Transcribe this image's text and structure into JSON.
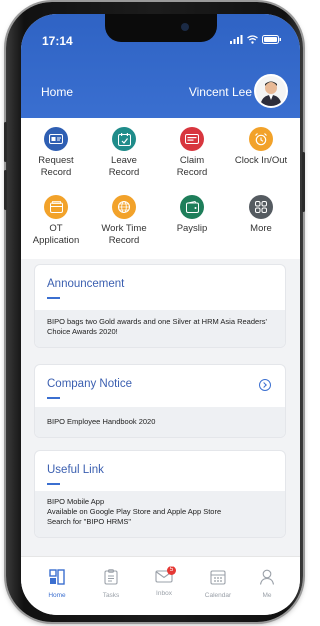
{
  "status_bar": {
    "time": "17:14"
  },
  "header": {
    "title": "Home",
    "user_name": "Vincent Lee"
  },
  "quick_actions": [
    {
      "line1": "Request",
      "line2": "Record",
      "icon": "id-card-icon",
      "color": "#2f5fb3"
    },
    {
      "line1": "Leave",
      "line2": "Record",
      "icon": "calendar-clock-icon",
      "color": "#1f8c8a"
    },
    {
      "line1": "Claim",
      "line2": "Record",
      "icon": "receipt-icon",
      "color": "#d8363e"
    },
    {
      "line1": "Clock In/Out",
      "line2": "",
      "icon": "alarm-clock-icon",
      "color": "#f2a22a"
    },
    {
      "line1": "OT",
      "line2": "Application",
      "icon": "folder-icon",
      "color": "#f2a22a"
    },
    {
      "line1": "Work Time",
      "line2": "Record",
      "icon": "globe-icon",
      "color": "#f2a22a"
    },
    {
      "line1": "Payslip",
      "line2": "",
      "icon": "wallet-icon",
      "color": "#1e7e5a"
    },
    {
      "line1": "More",
      "line2": "",
      "icon": "grid-icon",
      "color": "#555b61"
    }
  ],
  "announcement": {
    "title": "Announcement",
    "body": "BIPO bags two Gold awards and one Silver at HRM Asia Readers' Choice Awards 2020!"
  },
  "company_notice": {
    "title": "Company Notice",
    "body": "BIPO Employee Handbook 2020"
  },
  "useful_link": {
    "title": "Useful Link",
    "line1": "BIPO Mobile App",
    "line2": "Available on Google Play Store and Apple App Store",
    "line3": "Search for \"BIPO HRMS\""
  },
  "tabs": [
    {
      "label": "Home",
      "icon": "home-icon"
    },
    {
      "label": "Tasks",
      "icon": "clipboard-icon"
    },
    {
      "label": "Inbox",
      "icon": "mail-icon",
      "badge": "5"
    },
    {
      "label": "Calendar",
      "icon": "calendar-icon"
    },
    {
      "label": "Me",
      "icon": "person-icon"
    }
  ],
  "colors": {
    "accent": "#3b6fd0",
    "header_bg": "#2f63c4",
    "badge": "#e53935"
  }
}
